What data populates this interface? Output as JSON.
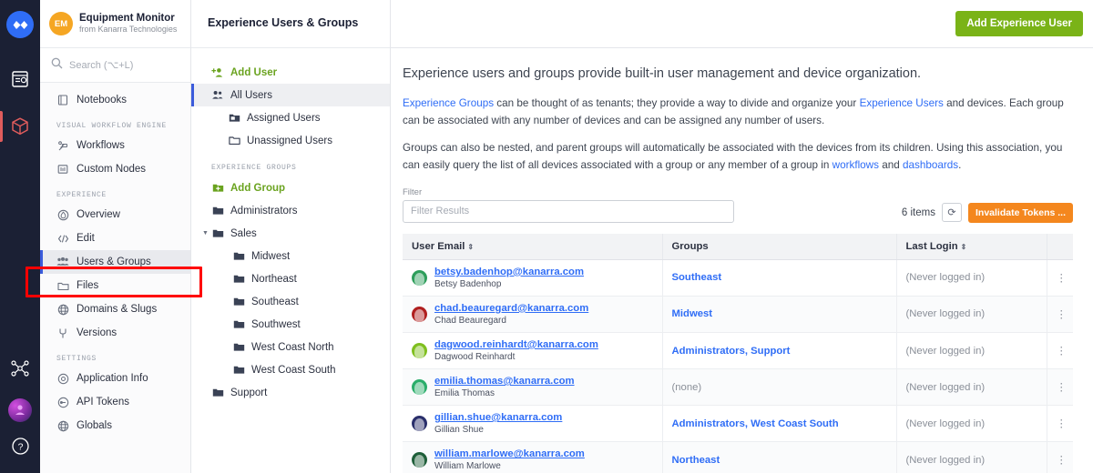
{
  "rail": {
    "logo_icon": "infinity-logo-icon",
    "icons": [
      {
        "name": "notebook-icon",
        "glyph": "▤"
      },
      {
        "name": "package-icon",
        "glyph": "◰"
      },
      {
        "name": "workflow-nodes-icon",
        "glyph": "⸬"
      },
      {
        "name": "user-avatar-icon",
        "glyph": ""
      },
      {
        "name": "help-icon",
        "glyph": "?"
      }
    ]
  },
  "sidebar": {
    "app_badge": "EM",
    "app_title": "Equipment Monitor",
    "app_subtitle": "from Kanarra Technologies",
    "search_placeholder": "Search (⌥+L)",
    "items": [
      {
        "label": "Notebooks",
        "icon": "notebook-icon",
        "selected": false
      },
      {
        "section": "VISUAL WORKFLOW ENGINE"
      },
      {
        "label": "Workflows",
        "icon": "workflow-icon",
        "selected": false
      },
      {
        "label": "Custom Nodes",
        "icon": "custom-node-icon",
        "selected": false
      },
      {
        "section": "EXPERIENCE"
      },
      {
        "label": "Overview",
        "icon": "overview-icon",
        "selected": false
      },
      {
        "label": "Edit",
        "icon": "edit-code-icon",
        "selected": false
      },
      {
        "label": "Users & Groups",
        "icon": "users-icon",
        "selected": true
      },
      {
        "label": "Files",
        "icon": "folder-icon",
        "selected": false
      },
      {
        "label": "Domains & Slugs",
        "icon": "globe-icon",
        "selected": false
      },
      {
        "label": "Versions",
        "icon": "branch-icon",
        "selected": false
      },
      {
        "section": "SETTINGS"
      },
      {
        "label": "Application Info",
        "icon": "info-gear-icon",
        "selected": false
      },
      {
        "label": "API Tokens",
        "icon": "token-icon",
        "selected": false
      },
      {
        "label": "Globals",
        "icon": "globe-icon",
        "selected": false
      }
    ]
  },
  "tree": {
    "add_user": "Add User",
    "items": [
      {
        "label": "All Users",
        "icon": "users-icon",
        "indent": 0,
        "selected": true
      },
      {
        "label": "Assigned Users",
        "icon": "assigned-folder-icon",
        "indent": 1,
        "selected": false
      },
      {
        "label": "Unassigned Users",
        "icon": "unassigned-folder-icon",
        "indent": 1,
        "selected": false
      }
    ],
    "groups_section": "EXPERIENCE GROUPS",
    "add_group": "Add Group",
    "groups": [
      {
        "label": "Administrators",
        "indent": 0,
        "caret": false
      },
      {
        "label": "Sales",
        "indent": 0,
        "caret": true
      },
      {
        "label": "Midwest",
        "indent": 1,
        "caret": false
      },
      {
        "label": "Northeast",
        "indent": 1,
        "caret": false
      },
      {
        "label": "Southeast",
        "indent": 1,
        "caret": false
      },
      {
        "label": "Southwest",
        "indent": 1,
        "caret": false
      },
      {
        "label": "West Coast North",
        "indent": 1,
        "caret": false
      },
      {
        "label": "West Coast South",
        "indent": 1,
        "caret": false
      },
      {
        "label": "Support",
        "indent": 0,
        "caret": false
      }
    ]
  },
  "header": {
    "breadcrumb": "Experience Users & Groups",
    "add_user_button": "Add Experience User"
  },
  "content": {
    "lead": "Experience users and groups provide built-in user management and device organization.",
    "p1_a": "Experience Groups",
    "p1_b": " can be thought of as tenants; they provide a way to divide and organize your ",
    "p1_c": "Experience Users",
    "p1_d": " and devices. Each group can be associated with any number of devices and can be assigned any number of users.",
    "p2_a": "Groups can also be nested, and parent groups will automatically be associated with the devices from its children. Using this association, you can easily query the list of all devices associated with a group or any member of a group in ",
    "p2_b": "workflows",
    "p2_c": " and ",
    "p2_d": "dashboards",
    "p2_e": "."
  },
  "filter": {
    "label": "Filter",
    "placeholder": "Filter Results",
    "value": "",
    "items_count": "6 items",
    "refresh_icon": "refresh-icon",
    "invalidate_button": "Invalidate Tokens ..."
  },
  "table": {
    "columns": [
      "User Email",
      "Groups",
      "Last Login"
    ],
    "rows": [
      {
        "email": "betsy.badenhop@kanarra.com",
        "name": "Betsy Badenhop",
        "groups": [
          "Southeast"
        ],
        "last_login": "(Never logged in)",
        "avatar_color": "#2e9e5b"
      },
      {
        "email": "chad.beauregard@kanarra.com",
        "name": "Chad Beauregard",
        "groups": [
          "Midwest"
        ],
        "last_login": "(Never logged in)",
        "avatar_color": "#b01f1f"
      },
      {
        "email": "dagwood.reinhardt@kanarra.com",
        "name": "Dagwood Reinhardt",
        "groups": [
          "Administrators",
          "Support"
        ],
        "last_login": "(Never logged in)",
        "avatar_color": "#7fbf1f"
      },
      {
        "email": "emilia.thomas@kanarra.com",
        "name": "Emilia Thomas",
        "groups": [
          "(none)"
        ],
        "last_login": "(Never logged in)",
        "avatar_color": "#2bae6b"
      },
      {
        "email": "gillian.shue@kanarra.com",
        "name": "Gillian Shue",
        "groups": [
          "Administrators",
          "West Coast South"
        ],
        "last_login": "(Never logged in)",
        "avatar_color": "#2a2f6b"
      },
      {
        "email": "william.marlowe@kanarra.com",
        "name": "William Marlowe",
        "groups": [
          "Northeast"
        ],
        "last_login": "(Never logged in)",
        "avatar_color": "#1f5f3a"
      }
    ],
    "kebab_icon": "more-vertical-icon"
  },
  "colors": {
    "accent_green": "#7ab317",
    "accent_orange": "#f4871e",
    "link_blue": "#2f6df6",
    "rail_bg": "#1b2034",
    "highlight_red": "#ff0000"
  }
}
